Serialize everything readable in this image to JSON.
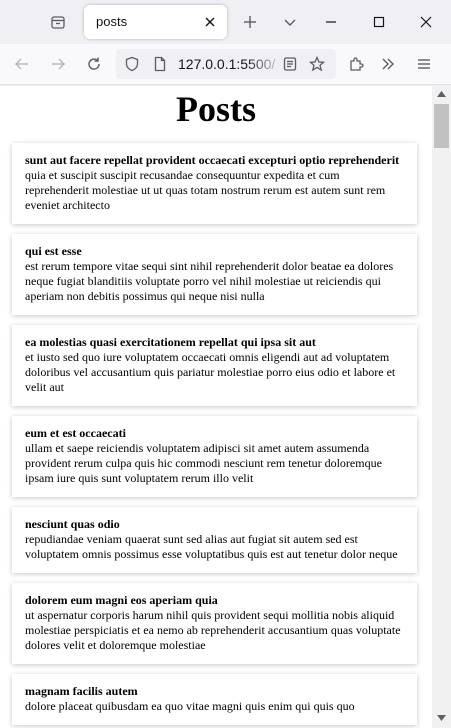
{
  "browser": {
    "tab": {
      "title": "posts"
    },
    "urlbar": {
      "url": "127.0.0.1:5500/"
    }
  },
  "page": {
    "title": "Posts",
    "posts": [
      {
        "title": "sunt aut facere repellat provident occaecati excepturi optio reprehenderit",
        "body": "quia et suscipit suscipit recusandae consequuntur expedita et cum reprehenderit molestiae ut ut quas totam nostrum rerum est autem sunt rem eveniet architecto"
      },
      {
        "title": "qui est esse",
        "body": "est rerum tempore vitae sequi sint nihil reprehenderit dolor beatae ea dolores neque fugiat blanditiis voluptate porro vel nihil molestiae ut reiciendis qui aperiam non debitis possimus qui neque nisi nulla"
      },
      {
        "title": "ea molestias quasi exercitationem repellat qui ipsa sit aut",
        "body": "et iusto sed quo iure voluptatem occaecati omnis eligendi aut ad voluptatem doloribus vel accusantium quis pariatur molestiae porro eius odio et labore et velit aut"
      },
      {
        "title": "eum et est occaecati",
        "body": "ullam et saepe reiciendis voluptatem adipisci sit amet autem assumenda provident rerum culpa quis hic commodi nesciunt rem tenetur doloremque ipsam iure quis sunt voluptatem rerum illo velit"
      },
      {
        "title": "nesciunt quas odio",
        "body": "repudiandae veniam quaerat sunt sed alias aut fugiat sit autem sed est voluptatem omnis possimus esse voluptatibus quis est aut tenetur dolor neque"
      },
      {
        "title": "dolorem eum magni eos aperiam quia",
        "body": "ut aspernatur corporis harum nihil quis provident sequi mollitia nobis aliquid molestiae perspiciatis et ea nemo ab reprehenderit accusantium quas voluptate dolores velit et doloremque molestiae"
      },
      {
        "title": "magnam facilis autem",
        "body": "dolore placeat quibusdam ea quo vitae magni quis enim qui quis quo"
      }
    ]
  },
  "icons": {
    "tab_list": "tab-list-icon",
    "close_tab": "close-icon",
    "new_tab": "plus-icon",
    "tabs_menu": "chevron-down-icon",
    "minimize": "minimize-icon",
    "maximize": "maximize-icon",
    "close_window": "close-icon",
    "back": "arrow-left-icon",
    "forward": "arrow-right-icon",
    "reload": "reload-icon",
    "tracking_protection": "shield-icon",
    "page_info": "page-icon",
    "reader_view": "reader-view-icon",
    "bookmark": "star-icon",
    "extensions": "puzzle-icon",
    "overflow": "double-chevron-right-icon",
    "app_menu": "hamburger-menu-icon"
  },
  "colors": {
    "chrome_bg": "#f0f0f4",
    "navbar_bg": "#f9f9fb",
    "page_bg": "#ffffff",
    "text": "#000000"
  }
}
